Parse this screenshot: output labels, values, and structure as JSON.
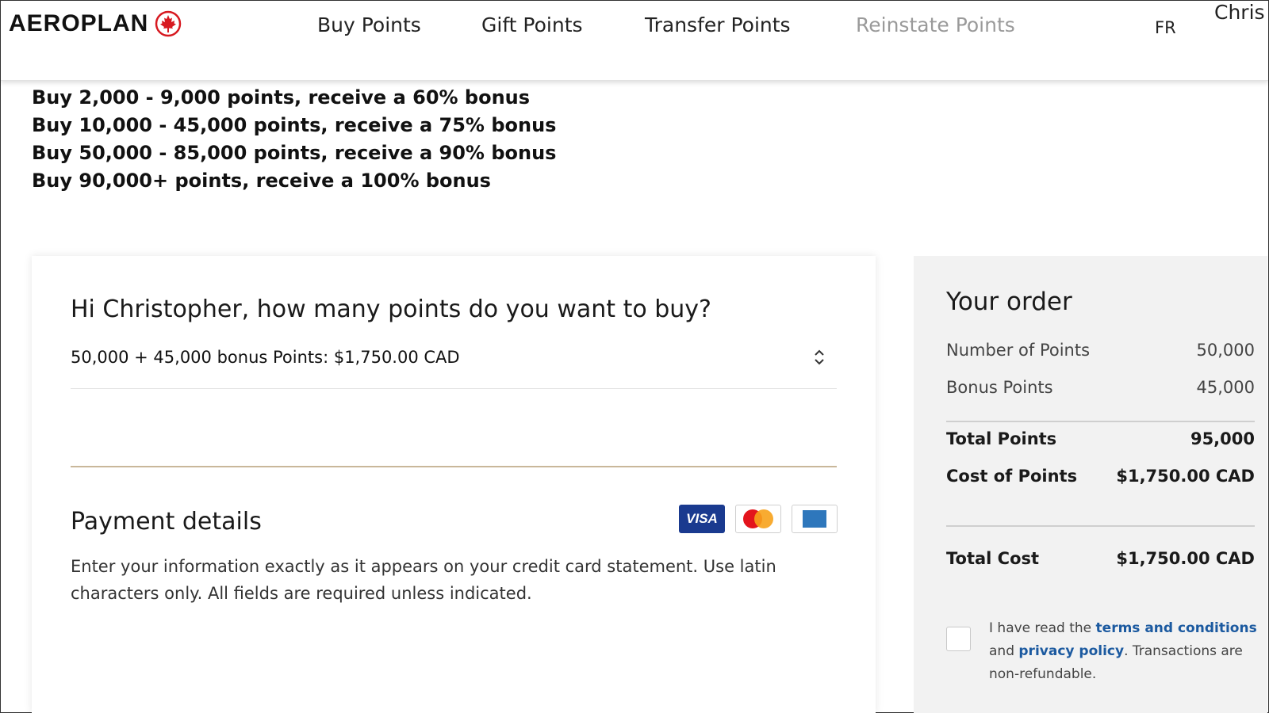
{
  "header": {
    "logo_text": "AEROPLAN",
    "nav": [
      {
        "label": "Buy Points",
        "state": "active"
      },
      {
        "label": "Gift Points",
        "state": "active"
      },
      {
        "label": "Transfer Points",
        "state": "active"
      },
      {
        "label": "Reinstate Points",
        "state": "disabled"
      }
    ],
    "language": "FR",
    "user_name": "Chris"
  },
  "bonus_tiers": [
    "Buy 2,000 - 9,000 points, receive a 60% bonus",
    "Buy 10,000 - 45,000 points, receive a 75% bonus",
    "Buy 50,000 - 85,000 points, receive a 90% bonus",
    "Buy 90,000+ points, receive a 100% bonus"
  ],
  "purchase": {
    "question": "Hi Christopher, how many points do you want to buy?",
    "selected_option": "50,000 + 45,000 bonus Points: $1,750.00 CAD"
  },
  "payment": {
    "title": "Payment details",
    "accepted_cards": [
      "visa",
      "mastercard",
      "american-express"
    ],
    "visa_label": "VISA",
    "instructions": "Enter your information exactly as it appears on your credit card statement. Use latin characters only. All fields are required unless indicated."
  },
  "order": {
    "title": "Your order",
    "number_of_points_label": "Number of Points",
    "number_of_points_value": "50,000",
    "bonus_points_label": "Bonus Points",
    "bonus_points_value": "45,000",
    "total_points_label": "Total Points",
    "total_points_value": "95,000",
    "cost_of_points_label": "Cost of Points",
    "cost_of_points_value": "$1,750.00 CAD",
    "total_cost_label": "Total Cost",
    "total_cost_value": "$1,750.00 CAD"
  },
  "terms": {
    "checked": false,
    "text_before": "I have read the ",
    "terms_link": "terms and conditions",
    "text_middle": " and ",
    "privacy_link": "privacy policy",
    "text_after": ". Transactions are non-refundable."
  },
  "colors": {
    "brand_red": "#d71920",
    "link_blue": "#1c5aa0",
    "divider_gold": "#c9b79a",
    "disabled_nav": "#9a9a9a",
    "order_panel_bg": "#f2f2f2",
    "visa_blue": "#1a3a8f"
  }
}
